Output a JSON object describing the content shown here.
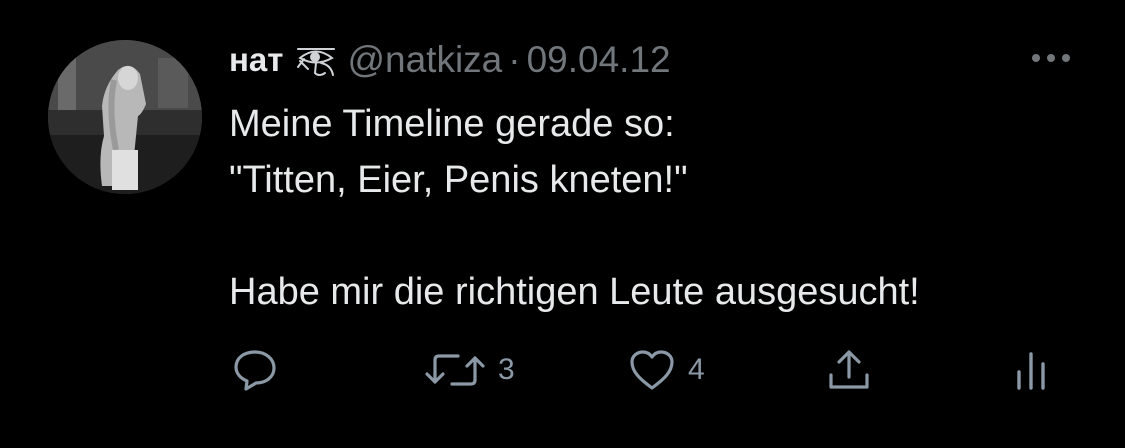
{
  "tweet": {
    "display_name": "нат",
    "handle": "@natkiza",
    "separator": "·",
    "date": "09.04.12",
    "text_lines": [
      "Meine Timeline gerade so:",
      "\"Titten, Eier, Penis kneten!\"",
      "",
      "Habe mir die richtigen Leute ausgesucht!"
    ],
    "actions": {
      "reply_icon": "speech-bubble-icon",
      "retweet_icon": "retweet-icon",
      "retweet_count": "3",
      "like_icon": "heart-icon",
      "like_count": "4",
      "share_icon": "share-upload-icon",
      "analytics_icon": "bar-chart-icon"
    },
    "icons": {
      "name_emoji": "eye-of-horus-icon",
      "more": "more-dots-icon"
    },
    "colors": {
      "background": "#000000",
      "text": "#e7e9ea",
      "secondary": "#71767b"
    }
  }
}
